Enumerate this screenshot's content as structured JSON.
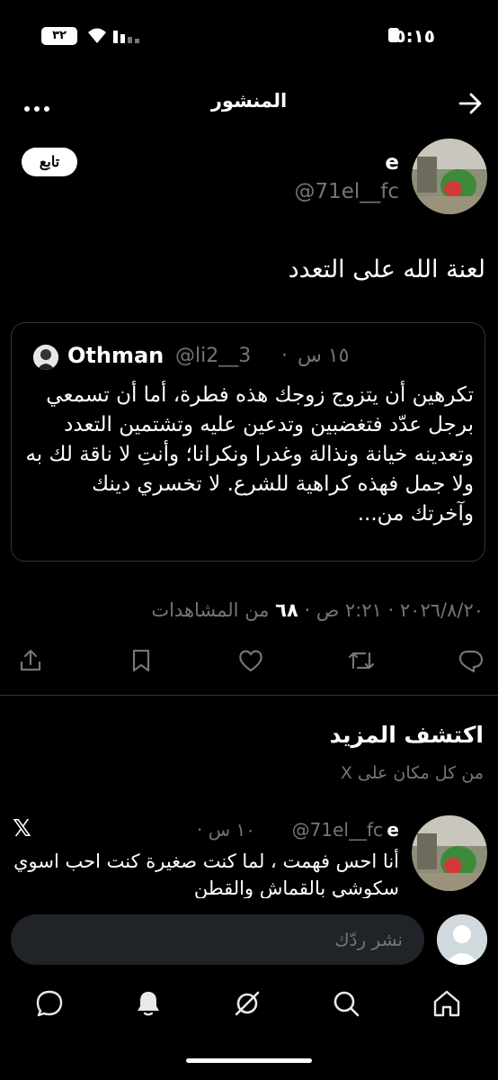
{
  "status_bar": {
    "time": "٥:١٥",
    "battery": "٣٢"
  },
  "header": {
    "title": "المنشور"
  },
  "post": {
    "author_name": "e",
    "author_handle": "@71el__fc",
    "follow_label": "تابع",
    "text": "لعنة الله على التعدد",
    "quote": {
      "name": "Othman",
      "handle": "@li2__3",
      "dot": "·",
      "time": "١٥ س",
      "body": "تكرهين أن يتزوج زوجك هذه فطرة، أما أن تسمعي برجل عدّد فتغضبين وتدعين عليه وتشتمين التعدد وتعدينه خيانة ونذالة وغدرا ونكرانا؛ وأنتِ لا ناقة لك به ولا جمل فهذه كراهية للشرع. لا تخسري دينك وآخرتك من..."
    },
    "meta": {
      "date": "٢٠٢٦/٨/٢٠",
      "time": "٢:٢١ ص",
      "views_count": "٦٨",
      "views_label": "من المشاهدات",
      "separator": "·"
    }
  },
  "discover": {
    "title": "اكتشف المزيد",
    "subtitle": "من كل مكان على X"
  },
  "post2": {
    "name": "e",
    "handle": "@71el__fc",
    "time": "١٠ س",
    "dot": "·",
    "x_logo": "𝕏",
    "text": "أنا احس فهمت ، لما كنت صغيرة كنت احب اسوي سكوشي بالقماش والقطن"
  },
  "reply": {
    "placeholder": "نشر ردّك"
  },
  "colors": {
    "background": "#000000",
    "muted": "#71767b",
    "divider": "#2f3336",
    "text": "#e7e9ea"
  },
  "icons": {
    "header": [
      "more-icon",
      "back-arrow-icon"
    ],
    "actions": [
      "share-icon",
      "bookmark-icon",
      "like-icon",
      "repost-icon",
      "reply-icon"
    ],
    "nav": [
      "messages-icon",
      "notifications-icon",
      "grok-icon",
      "search-icon",
      "home-icon"
    ]
  }
}
